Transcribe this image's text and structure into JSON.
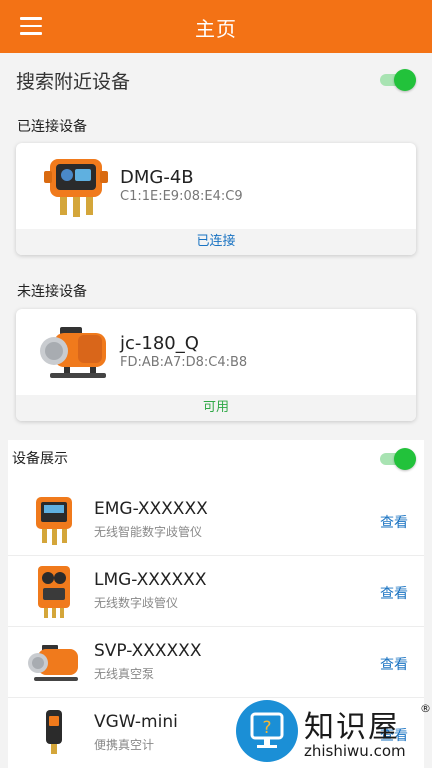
{
  "header": {
    "title": "主页"
  },
  "scan": {
    "label": "搜索附近设备",
    "enabled": true
  },
  "connected": {
    "section_label": "已连接设备",
    "device": {
      "name": "DMG-4B",
      "mac": "C1:1E:E9:08:E4:C9",
      "status": "已连接",
      "status_color": "#1a73c2"
    }
  },
  "disconnected": {
    "section_label": "未连接设备",
    "device": {
      "name": "jc-180_Q",
      "mac": "FD:AB:A7:D8:C4:B8",
      "status": "可用",
      "status_color": "#2fa846"
    }
  },
  "showcase": {
    "section_label": "设备展示",
    "enabled": true,
    "items": [
      {
        "name": "EMG-XXXXXX",
        "desc": "无线智能数字歧管仪",
        "action": "查看"
      },
      {
        "name": "LMG-XXXXXX",
        "desc": "无线数字歧管仪",
        "action": "查看"
      },
      {
        "name": "SVP-XXXXXX",
        "desc": "无线真空泵",
        "action": "查看"
      },
      {
        "name": "VGW-mini",
        "desc": "便携真空计",
        "action": "查看"
      }
    ]
  },
  "watermark": {
    "cn": "知识屋",
    "en": "zhishiwu.com",
    "reg": "®"
  },
  "colors": {
    "brand": "#f37215",
    "toggle_on": "#22c23b",
    "link": "#1a73c2"
  }
}
